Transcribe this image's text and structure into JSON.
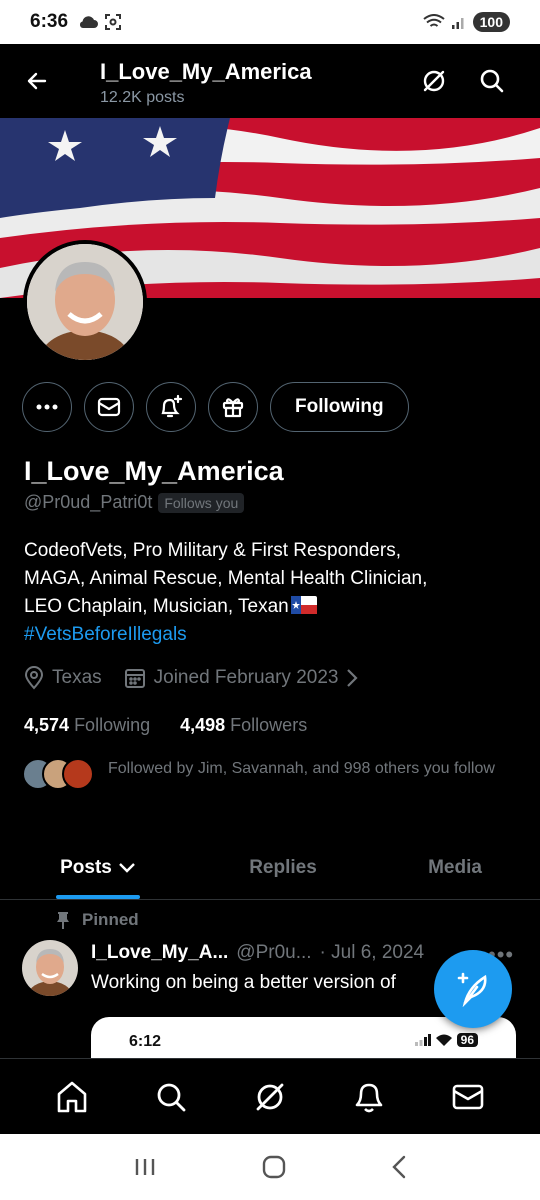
{
  "status_bar": {
    "time": "6:36",
    "battery": "100"
  },
  "header": {
    "title": "I_Love_My_America",
    "posts": "12.2K posts"
  },
  "profile": {
    "name": "I_Love_My_America",
    "handle": "@Pr0ud_Patri0t",
    "follows_you": "Follows you",
    "bio_line1": "CodeofVets, Pro Military & First Responders,",
    "bio_line2": "MAGA, Animal Rescue, Mental Health Clinician,",
    "bio_line3": "LEO Chaplain, Musician, Texan",
    "bio_hashtag": "#VetsBeforeIllegals",
    "location": "Texas",
    "joined": "Joined February 2023",
    "following_count": "4,574",
    "following_label": "Following",
    "followers_count": "4,498",
    "followers_label": "Followers",
    "followed_by": "Followed by Jim, Savannah, and 998 others you follow"
  },
  "actions": {
    "following_button": "Following"
  },
  "tabs": [
    {
      "label": "Posts"
    },
    {
      "label": "Replies"
    },
    {
      "label": "Media"
    }
  ],
  "pinned_post": {
    "pinned_label": "Pinned",
    "author": "I_Love_My_A...",
    "handle": "@Pr0u...",
    "date": "· Jul 6, 2024",
    "text": "Working on being a better version of",
    "embed_time": "6:12",
    "embed_battery": "96"
  },
  "colors": {
    "accent": "#1d9bf0",
    "background": "#000000",
    "muted": "#71767b"
  }
}
